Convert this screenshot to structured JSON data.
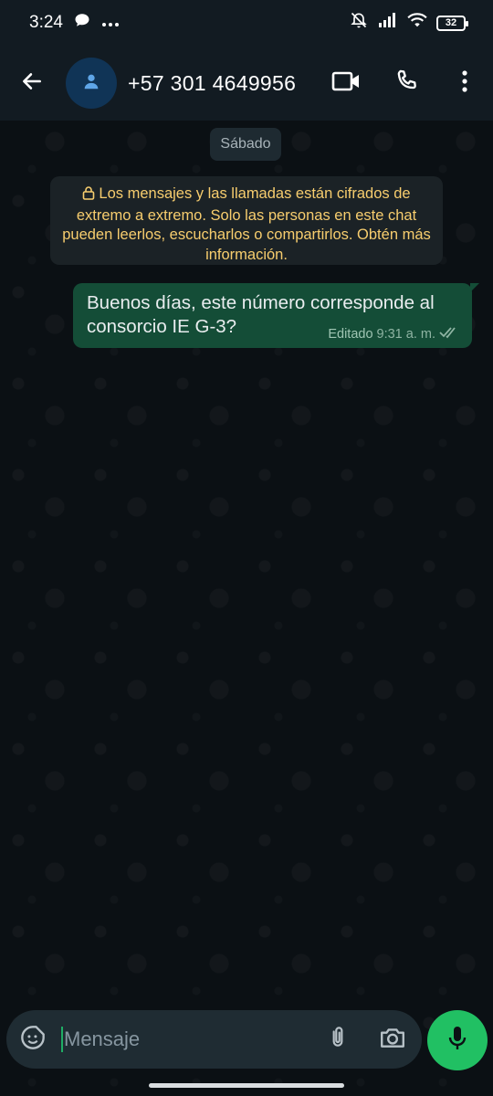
{
  "status_bar": {
    "time": "3:24",
    "battery": "32"
  },
  "header": {
    "contact": "+57 301 4649956"
  },
  "chat": {
    "date_chip": "Sábado",
    "encryption_notice": "Los mensajes y las llamadas están cifrados de extremo a extremo. Solo las personas en este chat pueden leerlos, escucharlos o compartirlos. Obtén más información.",
    "messages": [
      {
        "text": "Buenos días, este número corresponde al consorcio IE G-3?",
        "edited_label": "Editado",
        "time": "9:31 a. m."
      }
    ]
  },
  "composer": {
    "placeholder": "Mensaje"
  },
  "icons": [
    "chat-bubble-icon",
    "more-dots-icon",
    "muted-icon",
    "signal-icon",
    "wifi-icon",
    "battery-icon",
    "back-arrow-icon",
    "person-icon",
    "video-call-icon",
    "phone-icon",
    "more-vert-icon",
    "lock-icon",
    "double-check-icon",
    "sticker-icon",
    "attach-icon",
    "camera-icon",
    "mic-icon"
  ],
  "colors": {
    "outgoing_bubble": "#144d37",
    "notice_text": "#f7cd6e",
    "mic_button": "#21c063",
    "background": "#0b1014"
  }
}
